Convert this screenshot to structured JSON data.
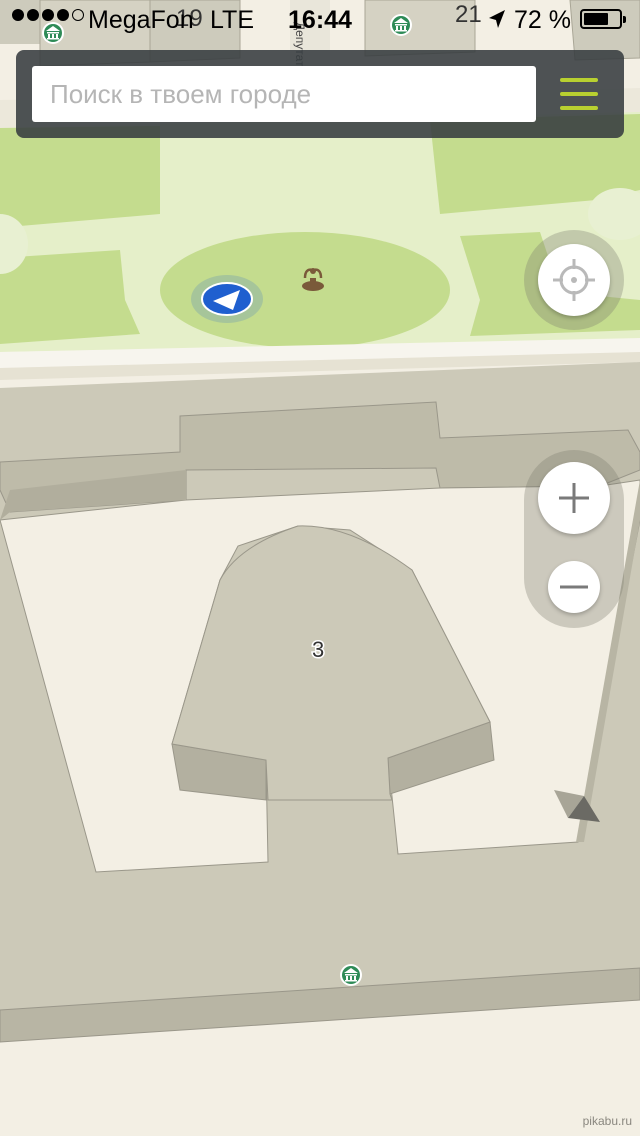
{
  "status_bar": {
    "carrier": "MegaFon",
    "network": "LTE",
    "time": "16:44",
    "battery_percent": "72 %",
    "battery_level": 0.72,
    "signal_bars_filled": 4,
    "signal_bars_total": 5
  },
  "search": {
    "placeholder": "Поиск в твоем городе",
    "value": ""
  },
  "map": {
    "house_number_left": "19",
    "house_number_right": "21",
    "building_number": "3",
    "street_label": "Депутатская"
  },
  "controls": {
    "menu_icon": "hamburger-icon",
    "locate_icon": "crosshair-icon",
    "zoom_in_icon": "plus-icon",
    "zoom_out_icon": "minus-icon"
  },
  "colors": {
    "park_green": "#c4dc8e",
    "accent_menu": "#b8d030",
    "user_marker": "#1f5fcf",
    "landmark_teal": "#2e8b57"
  },
  "watermark": "pikabu.ru"
}
